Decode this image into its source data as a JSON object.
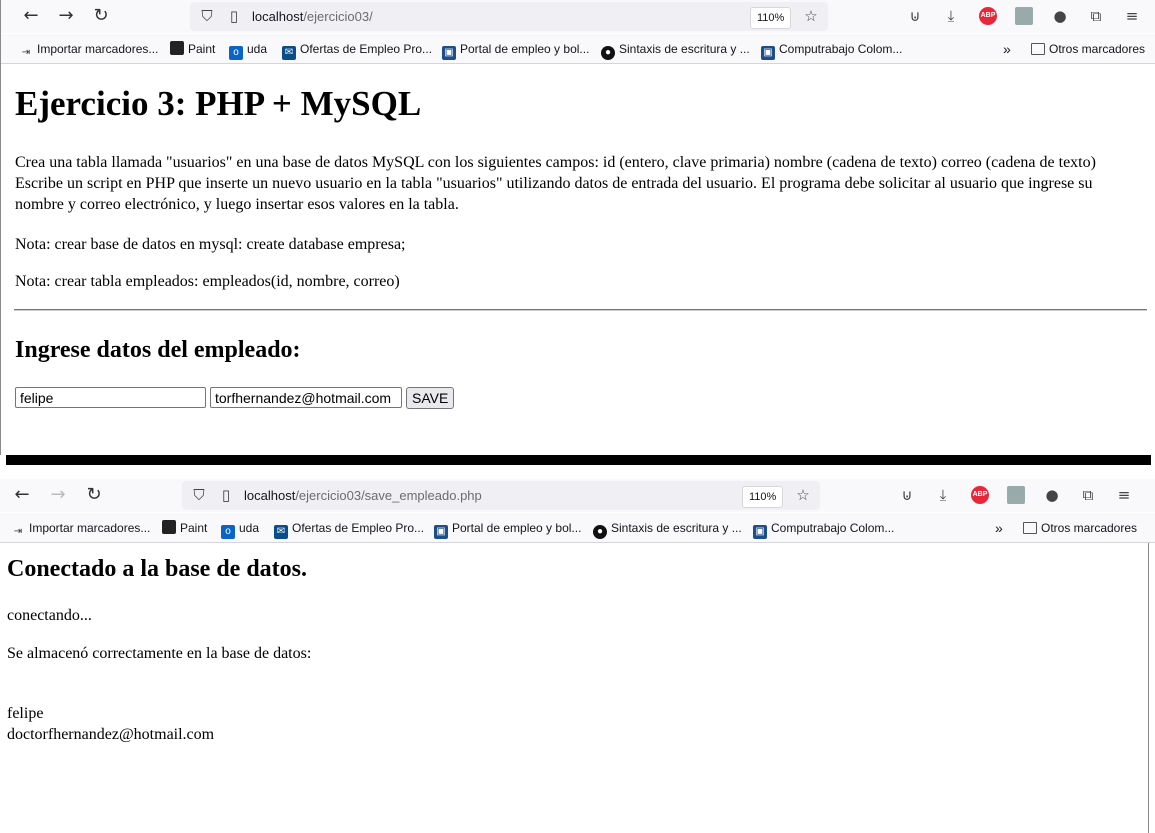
{
  "browser": {
    "zoom": "110%",
    "bookmarks": [
      {
        "label": "Importar marcadores...",
        "icon": "import-icon"
      },
      {
        "label": "Paint",
        "icon": "paint-icon"
      },
      {
        "label": "uda",
        "icon": "outlook-icon"
      },
      {
        "label": "Ofertas de Empleo Pro...",
        "icon": "mail-icon"
      },
      {
        "label": "Portal de empleo y bol...",
        "icon": "portal-icon"
      },
      {
        "label": "Sintaxis de escritura y ...",
        "icon": "github-icon"
      },
      {
        "label": "Computrabajo Colom...",
        "icon": "computrabajo-icon"
      }
    ],
    "other_bookmarks": "Otros marcadores"
  },
  "window1": {
    "url_host": "localhost",
    "url_path": "/ejercicio03/",
    "title": "Ejercicio 3: PHP + MySQL",
    "description": "Crea una tabla llamada \"usuarios\" en una base de datos MySQL con los siguientes campos: id (entero, clave primaria) nombre (cadena de texto) correo (cadena de texto) Escribe un script en PHP que inserte un nuevo usuario en la tabla \"usuarios\" utilizando datos de entrada del usuario. El programa debe solicitar al usuario que ingrese su nombre y correo electrónico, y luego insertar esos valores en la tabla.",
    "note1": "Nota: crear base de datos en mysql: create database empresa;",
    "note2": "Nota: crear tabla empleados: empleados(id, nombre, correo)",
    "form_title": "Ingrese datos del empleado:",
    "name_value": "felipe",
    "email_value": "torfhernandez@hotmail.com",
    "save_label": "SAVE"
  },
  "window2": {
    "url_host": "localhost",
    "url_path": "/ejercicio03/save_empleado.php",
    "heading": "Conectado a la base de datos.",
    "status1": "conectando...",
    "status2": "Se almacenó correctamente en la base de datos:",
    "saved_name": "felipe",
    "saved_email": "doctorfhernandez@hotmail.com"
  }
}
